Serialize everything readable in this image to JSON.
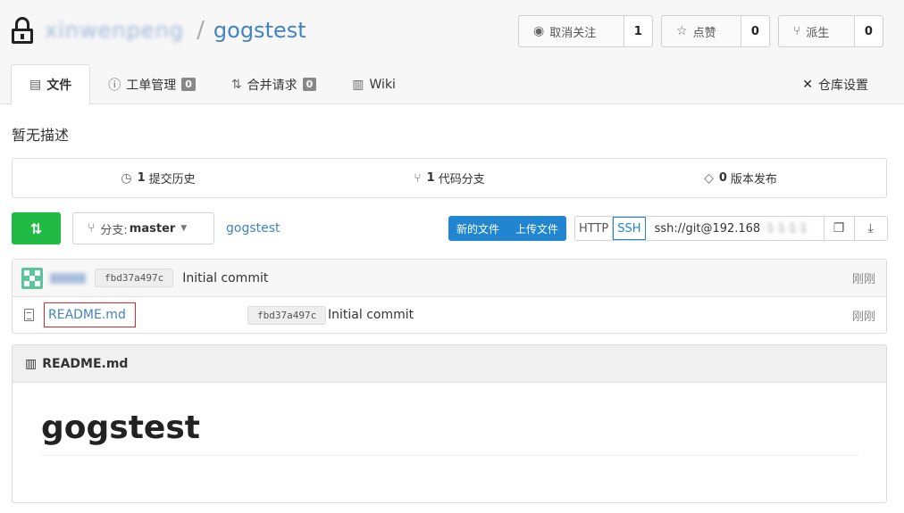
{
  "repo": {
    "owner": "xinwenpeng",
    "separator": "/",
    "name": "gogstest"
  },
  "actions": {
    "watch": {
      "label": "取消关注",
      "count": "1"
    },
    "star": {
      "label": "点赞",
      "count": "0"
    },
    "fork": {
      "label": "派生",
      "count": "0"
    }
  },
  "tabs": [
    {
      "label": "文件",
      "badge": ""
    },
    {
      "label": "工单管理",
      "badge": "0"
    },
    {
      "label": "合并请求",
      "badge": "0"
    },
    {
      "label": "Wiki",
      "badge": ""
    }
  ],
  "settings_label": "仓库设置",
  "description": "暂无描述",
  "stats": {
    "commits": {
      "count": "1",
      "label": "提交历史"
    },
    "branches": {
      "count": "1",
      "label": "代码分支"
    },
    "releases": {
      "count": "0",
      "label": "版本发布"
    }
  },
  "toolbar": {
    "branch_prefix": "分支:",
    "branch_name": "master",
    "breadcrumb": "gogstest",
    "new_file": "新的文件",
    "upload_file": "上传文件",
    "http": "HTTP",
    "ssh": "SSH",
    "clone_url": "ssh://git@192.168",
    "clone_url_hidden": "·1·1·1·1"
  },
  "latest_commit": {
    "sha": "fbd37a497c",
    "message": "Initial commit",
    "time": "刚刚"
  },
  "files": [
    {
      "name": "README.md",
      "sha": "fbd37a497c",
      "message": "Initial commit",
      "time": "刚刚"
    }
  ],
  "readme": {
    "title": "README.md",
    "heading": "gogstest"
  },
  "colors": {
    "link": "#4183c4",
    "green": "#21ba45",
    "blue": "#2185d0",
    "highlight": "#db2828"
  }
}
